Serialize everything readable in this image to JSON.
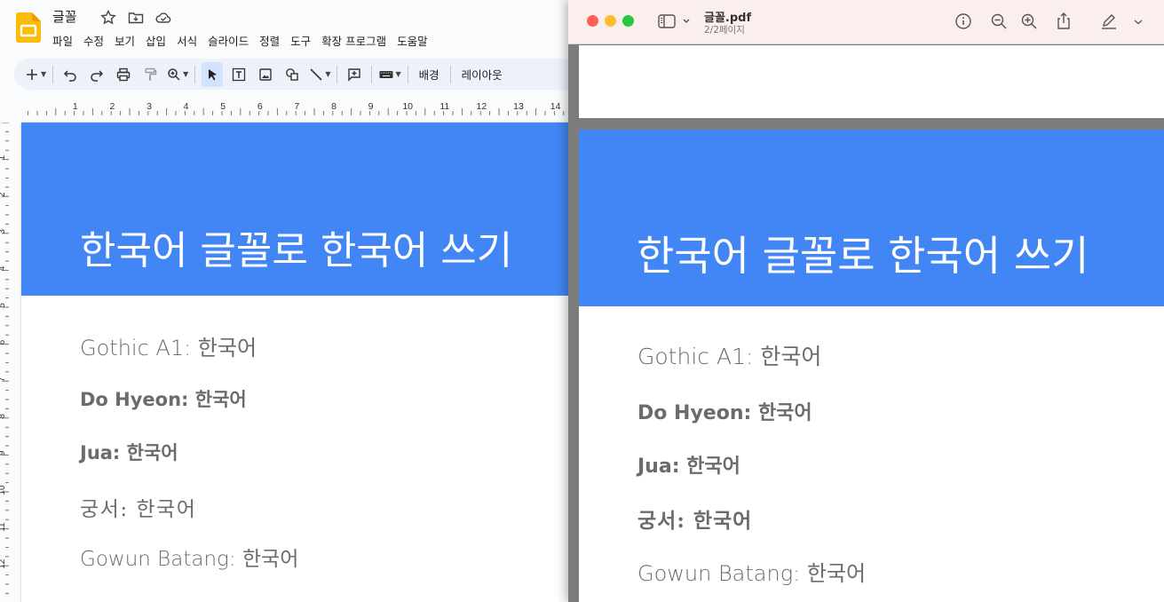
{
  "slides_app": {
    "doc_title": "글꼴",
    "menu": [
      "파일",
      "수정",
      "보기",
      "삽입",
      "서식",
      "슬라이드",
      "정렬",
      "도구",
      "확장 프로그램",
      "도움말"
    ],
    "toolbar": {
      "background_label": "배경",
      "layout_label": "레이아웃"
    },
    "ruler_h_numbers": [
      "1",
      "2",
      "3",
      "4",
      "5",
      "6",
      "7",
      "8",
      "9",
      "10",
      "11",
      "12",
      "13",
      "14"
    ],
    "ruler_v_numbers": [
      "1",
      "2",
      "3",
      "4",
      "5",
      "6",
      "7",
      "8",
      "9",
      "10",
      "11",
      "12"
    ]
  },
  "slide": {
    "header_color": "#4285f4",
    "title": "한국어 글꼴로 한국어 쓰기",
    "font_lines": [
      "Gothic A1: 한국어",
      "Do Hyeon: 한국어",
      "Jua: 한국어",
      "궁서:  한국어",
      "Gowun Batang: 한국어"
    ]
  },
  "preview_app": {
    "filename": "글꼴.pdf",
    "page_indicator": "2/2페이지",
    "traffic_lights": [
      "#ff5f57",
      "#febc2e",
      "#28c840"
    ],
    "pdf_font_lines": [
      "Gothic A1: 한국어",
      "Do Hyeon: 한국어",
      "Jua: 한국어",
      "궁서: 한국어",
      "Gowun Batang: 한국어"
    ]
  }
}
